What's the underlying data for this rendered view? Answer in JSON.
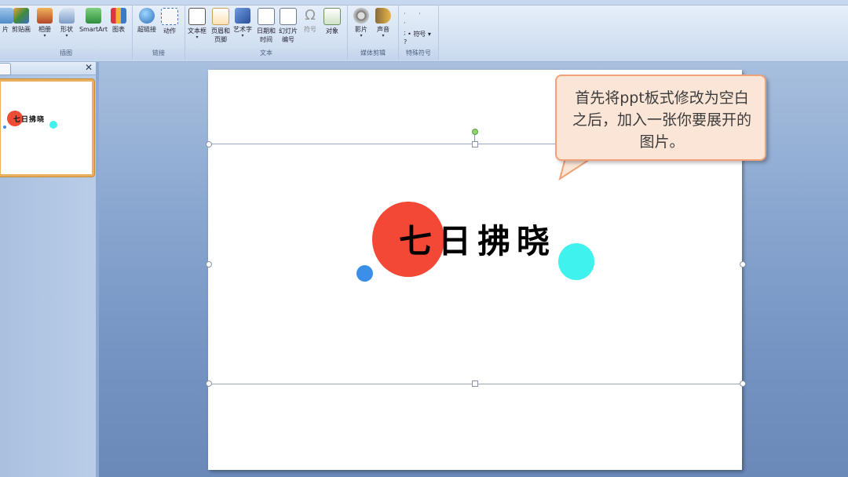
{
  "ribbon": {
    "groups": [
      {
        "label": "插图",
        "buttons": [
          {
            "label": "片",
            "icon": "picture-icon"
          },
          {
            "label": "剪贴画",
            "icon": "clipart-icon"
          },
          {
            "label": "相册",
            "icon": "album-icon"
          },
          {
            "label": "形状",
            "icon": "shapes-icon"
          },
          {
            "label": "SmartArt",
            "icon": "smartart-icon"
          },
          {
            "label": "图表",
            "icon": "chart-icon"
          }
        ]
      },
      {
        "label": "链接",
        "buttons": [
          {
            "label": "超链接",
            "icon": "hyperlink-icon"
          },
          {
            "label": "动作",
            "icon": "action-icon"
          }
        ]
      },
      {
        "label": "文本",
        "buttons": [
          {
            "label": "文本框",
            "icon": "textbox-icon"
          },
          {
            "label": "页眉和页脚",
            "icon": "header-footer-icon"
          },
          {
            "label": "艺术字",
            "icon": "wordart-icon"
          },
          {
            "label": "日期和时间",
            "icon": "datetime-icon"
          },
          {
            "label": "幻灯片编号",
            "icon": "slide-number-icon"
          },
          {
            "label": "符号",
            "icon": "symbol-icon"
          },
          {
            "label": "对象",
            "icon": "object-icon"
          }
        ]
      },
      {
        "label": "媒体剪辑",
        "buttons": [
          {
            "label": "影片",
            "icon": "movie-icon"
          },
          {
            "label": "声音",
            "icon": "sound-icon"
          }
        ]
      },
      {
        "label": "特殊符号",
        "buttons": [
          {
            "label": "符号",
            "icon": "special-symbol-icon"
          }
        ]
      }
    ]
  },
  "thumbnail": {
    "title": "七日拂晓"
  },
  "slide": {
    "title": "七日拂晓",
    "colors": {
      "red": "#f34835",
      "cyan": "#40f2ee",
      "blue": "#3b8fe9"
    }
  },
  "callout": {
    "text": "首先将ppt板式修改为空白之后，加入一张你要展开的图片。"
  }
}
